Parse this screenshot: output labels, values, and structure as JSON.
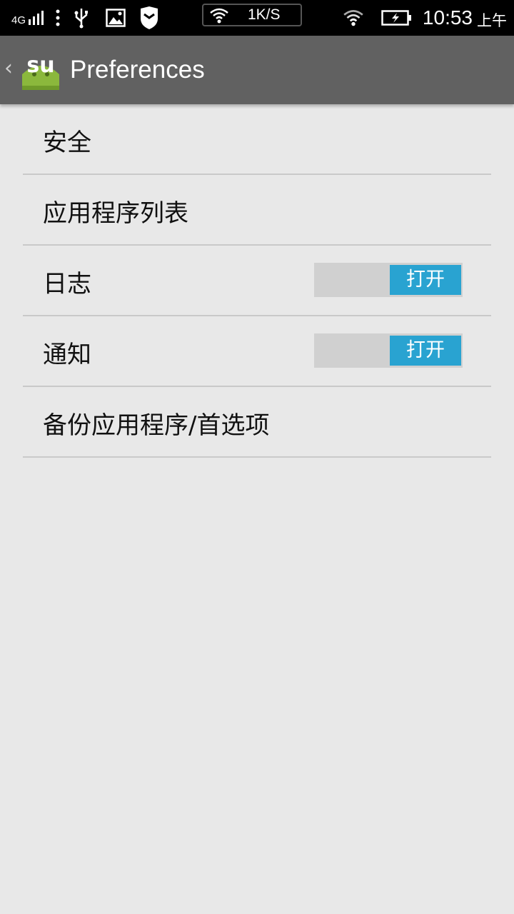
{
  "status_bar": {
    "network": "4G",
    "speed": "1K/S",
    "time": "10:53",
    "ampm": "上午"
  },
  "action_bar": {
    "logo_text": "su",
    "title": "Preferences"
  },
  "preferences": {
    "items": [
      {
        "label": "安全"
      },
      {
        "label": "应用程序列表"
      },
      {
        "label": "日志",
        "toggle_label": "打开",
        "toggle_on": true
      },
      {
        "label": "通知",
        "toggle_label": "打开",
        "toggle_on": true
      },
      {
        "label": "备份应用程序/首选项"
      }
    ]
  },
  "colors": {
    "action_bar_bg": "#616161",
    "page_bg": "#e8e8e8",
    "toggle_on": "#29a3d1",
    "toggle_track": "#d0d0d0",
    "logo_green": "#8bb83c"
  }
}
